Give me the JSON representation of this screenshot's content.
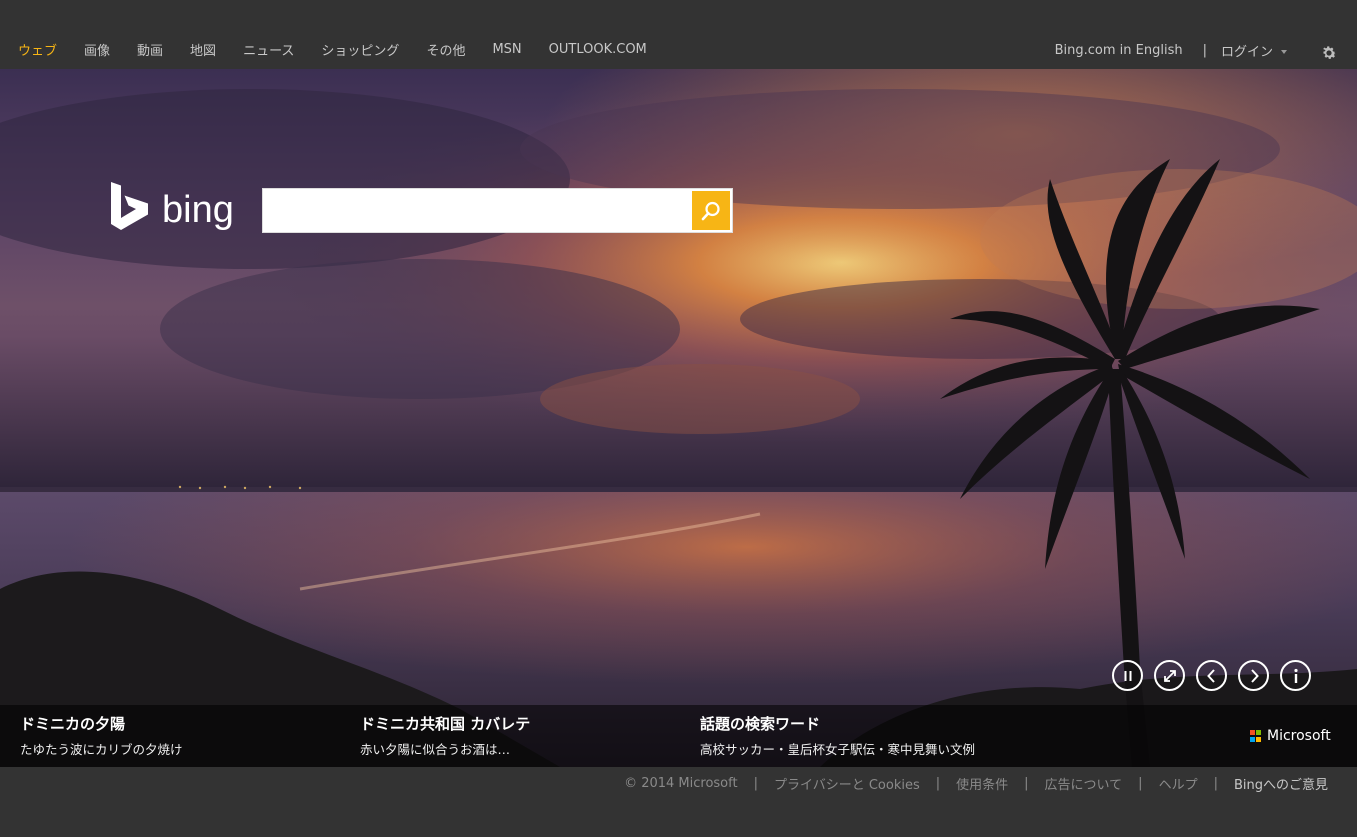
{
  "nav": {
    "items": [
      {
        "label": "ウェブ",
        "active": true
      },
      {
        "label": "画像"
      },
      {
        "label": "動画"
      },
      {
        "label": "地図"
      },
      {
        "label": "ニュース"
      },
      {
        "label": "ショッピング"
      },
      {
        "label": "その他"
      },
      {
        "label": "MSN"
      },
      {
        "label": "OUTLOOK.COM"
      }
    ]
  },
  "header": {
    "english_link": "Bing.com in English",
    "separator": "|",
    "login_label": "ログイン",
    "settings_icon": "gear-icon"
  },
  "logo": {
    "text": "bing"
  },
  "search": {
    "value": "",
    "placeholder": "",
    "button_icon": "magnifier-icon"
  },
  "controls": [
    "pause-icon",
    "fullscreen-icon",
    "previous-icon",
    "next-icon",
    "info-icon"
  ],
  "captions": [
    {
      "title": "ドミニカの夕陽",
      "subtitle": "たゆたう波にカリブの夕焼け"
    },
    {
      "title": "ドミニカ共和国 カバレテ",
      "subtitle": "赤い夕陽に似合うお酒は…"
    },
    {
      "title": "話題の検索ワード",
      "subtitle": "高校サッカー・皇后杯女子駅伝・寒中見舞い文例"
    }
  ],
  "brand": {
    "text": "Microsoft",
    "colors": [
      "#f25022",
      "#7fba00",
      "#00a4ef",
      "#ffb900"
    ]
  },
  "footer": {
    "items": [
      "© 2014 Microsoft",
      "プライバシーと Cookies",
      "使用条件",
      "広告について",
      "ヘルプ",
      "Bingへのご意見"
    ],
    "separator": "|"
  },
  "colors": {
    "accent": "#f7b515",
    "topbar": "#333333"
  }
}
